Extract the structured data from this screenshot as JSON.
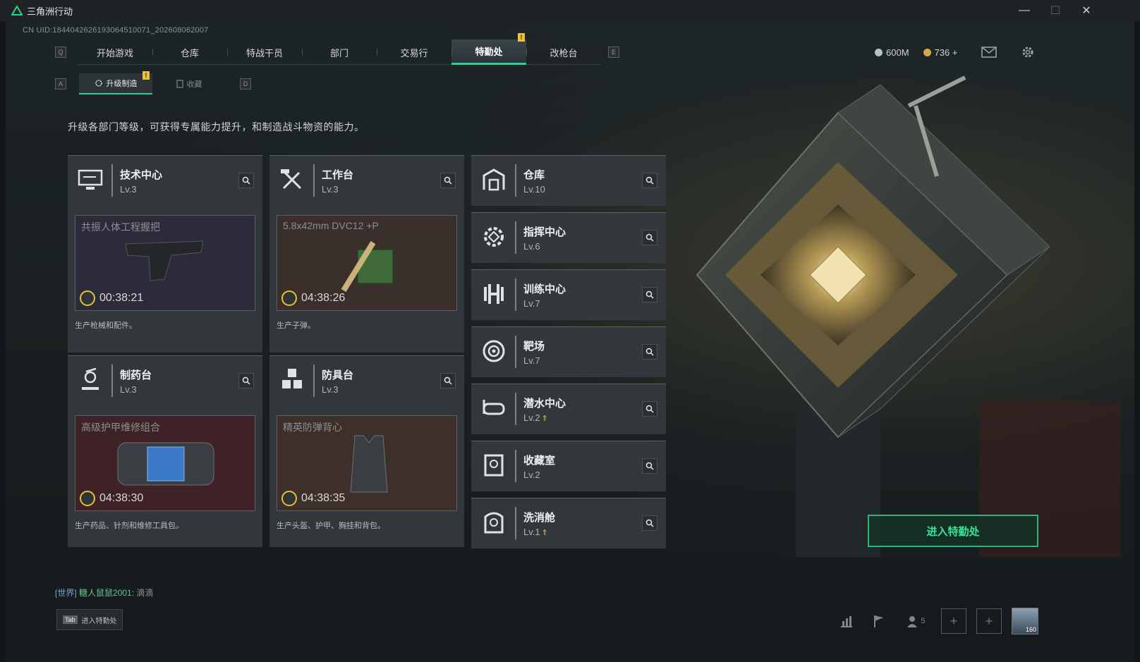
{
  "window": {
    "title": "三角洲行动",
    "controls": {
      "minimize": "—",
      "maximize": "☐",
      "close": "✕"
    }
  },
  "uid": "CN UID:1844042626193064510071_202608062007",
  "key_hints": {
    "left": "Q",
    "right": "E",
    "sub_left": "A",
    "sub_right": "D",
    "tab": "Tab"
  },
  "main_tabs": [
    {
      "label": "开始游戏",
      "active": false
    },
    {
      "label": "仓库",
      "active": false
    },
    {
      "label": "特战干员",
      "active": false
    },
    {
      "label": "部门",
      "active": false
    },
    {
      "label": "交易行",
      "active": false
    },
    {
      "label": "特勤处",
      "active": true,
      "badge": "!"
    },
    {
      "label": "改枪台",
      "active": false
    }
  ],
  "currency": {
    "silver": "600M",
    "gold": "736",
    "add": "+"
  },
  "sub_tabs": [
    {
      "label": "升级制造",
      "active": true,
      "badge": "!"
    },
    {
      "label": "收藏",
      "active": false
    }
  ],
  "description": "升级各部门等级，可获得专属能力提升，和制造战斗物资的能力。",
  "production": [
    {
      "name": "技术中心",
      "level": "Lv.3",
      "icon": "monitor-icon",
      "item": "共振人体工程握把",
      "timer": "00:38:21",
      "caption": "生产枪械和配件。",
      "bg": "#2d2a3a"
    },
    {
      "name": "工作台",
      "level": "Lv.3",
      "icon": "hammer-wrench-icon",
      "item": "5.8x42mm DVC12 +P",
      "timer": "04:38:26",
      "caption": "生产子弹。",
      "bg": "#3a2f2a"
    },
    {
      "name": "制药台",
      "level": "Lv.3",
      "icon": "microscope-icon",
      "item": "高级护甲维修组合",
      "timer": "04:38:30",
      "caption": "生产药品、针剂和维修工具包。",
      "bg": "#3f2226"
    },
    {
      "name": "防具台",
      "level": "Lv.3",
      "icon": "boxes-icon",
      "item": "精英防弹背心",
      "timer": "04:38:35",
      "caption": "生产头盔、护甲、胸挂和背包。",
      "bg": "#3d2f2a"
    }
  ],
  "facilities": [
    {
      "name": "仓库",
      "level": "Lv.10",
      "icon": "warehouse-icon",
      "upgradable": false
    },
    {
      "name": "指挥中心",
      "level": "Lv.6",
      "icon": "command-gear-icon",
      "upgradable": false
    },
    {
      "name": "训练中心",
      "level": "Lv.7",
      "icon": "dumbbell-icon",
      "upgradable": false
    },
    {
      "name": "靶场",
      "level": "Lv.7",
      "icon": "target-icon",
      "upgradable": false
    },
    {
      "name": "潜水中心",
      "level": "Lv.2",
      "icon": "diving-mask-icon",
      "upgradable": true
    },
    {
      "name": "收藏室",
      "level": "Lv.2",
      "icon": "collection-icon",
      "upgradable": false
    },
    {
      "name": "洗消舱",
      "level": "Lv.1",
      "icon": "decontamination-icon",
      "upgradable": true
    }
  ],
  "enter_button": "进入特勤处",
  "chat": {
    "channel": "[世界]",
    "user": "糖人鼠鼠2001:",
    "message": "滴滴"
  },
  "tab_hint": "进入特勤处",
  "bottom_bar": {
    "squad_count": "5",
    "avatar_level": "160"
  },
  "colors": {
    "accent": "#2fd08e",
    "badge": "#e8c23a",
    "card": "#343a3e"
  }
}
